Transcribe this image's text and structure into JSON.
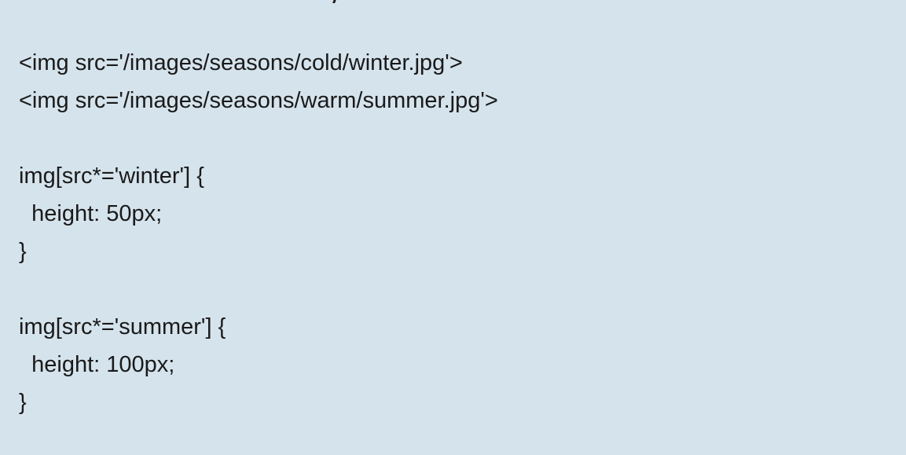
{
  "code": {
    "lines": [
      "<img src='/images/seasons/cold/winter.jpg'>",
      "<img src='/images/seasons/warm/summer.jpg'>",
      "",
      "img[src*='winter'] {",
      "  height: 50px;",
      "}",
      "",
      "img[src*='summer'] {",
      "  height: 100px;",
      "}"
    ]
  }
}
